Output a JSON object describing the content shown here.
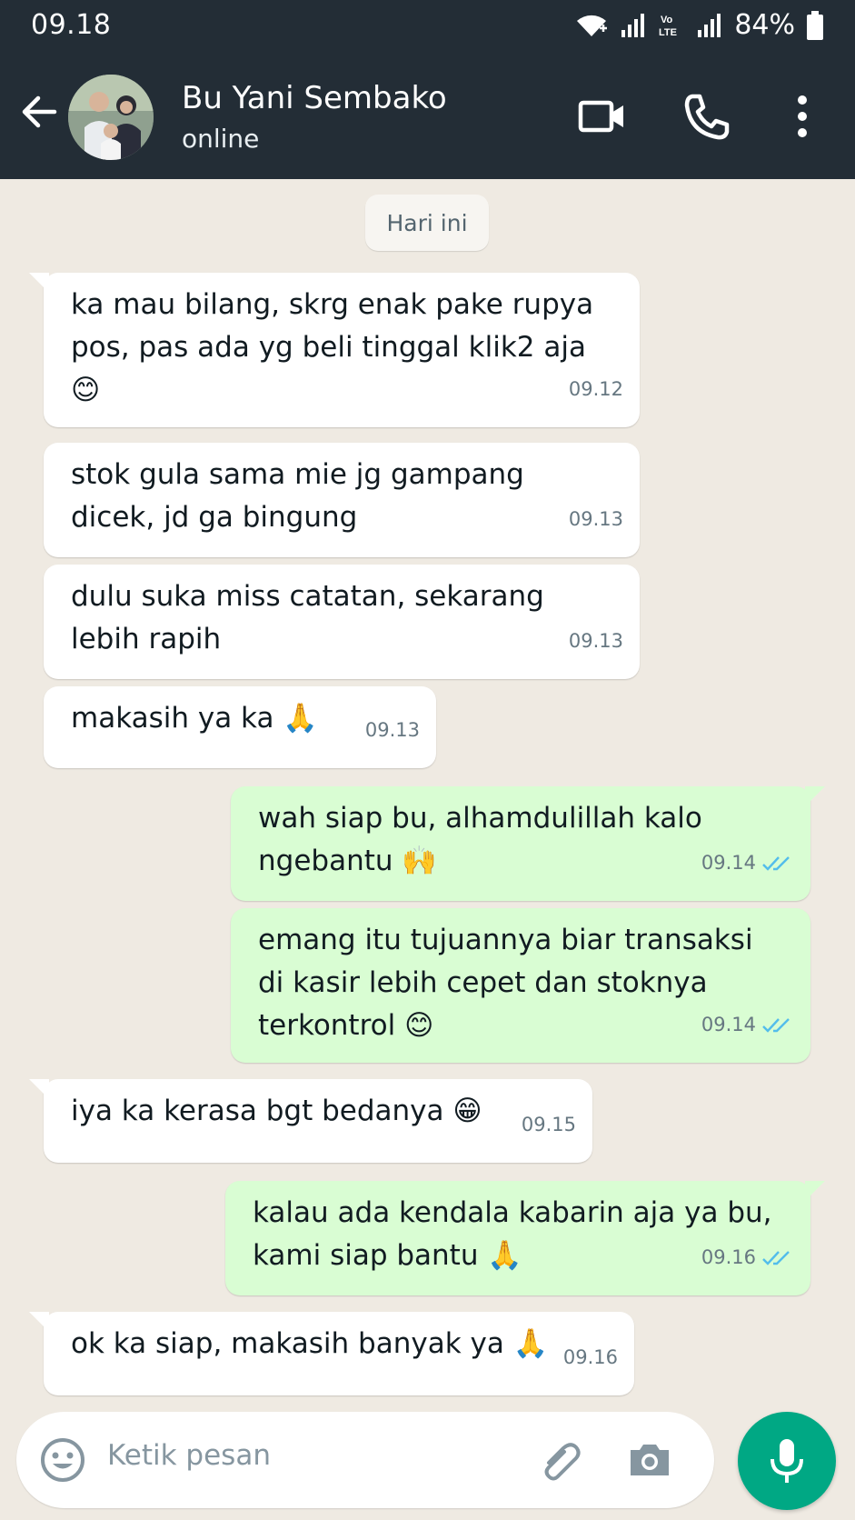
{
  "status_bar": {
    "time": "09.18",
    "battery": "84%",
    "network_label": "Vo LTE"
  },
  "header": {
    "contact_name": "Bu Yani Sembako",
    "status": "online"
  },
  "chat": {
    "date_chip": "Hari ini",
    "messages": [
      {
        "dir": "in",
        "text": "ka mau bilang, skrg enak pake rupya pos, pas ada yg beli tinggal klik2 aja 😊",
        "time": "09.12"
      },
      {
        "dir": "in",
        "text": "stok gula sama mie jg gampang dicek, jd ga bingung",
        "time": "09.13"
      },
      {
        "dir": "in",
        "text": "dulu suka miss catatan, sekarang lebih rapih",
        "time": "09.13"
      },
      {
        "dir": "in",
        "text": "makasih ya ka 🙏",
        "time": "09.13"
      },
      {
        "dir": "out",
        "text": "wah siap bu, alhamdulillah kalo ngebantu 🙌",
        "time": "09.14"
      },
      {
        "dir": "out",
        "text": "emang itu tujuannya biar transaksi di kasir lebih cepet dan stoknya terkontrol 😊",
        "time": "09.14"
      },
      {
        "dir": "in",
        "text": "iya ka kerasa bgt bedanya 😁",
        "time": "09.15"
      },
      {
        "dir": "out",
        "text": "kalau ada kendala kabarin aja ya bu, kami siap bantu 🙏",
        "time": "09.16"
      },
      {
        "dir": "in",
        "text": "ok ka siap, makasih banyak ya 🙏",
        "time": "09.16"
      }
    ]
  },
  "input": {
    "placeholder": "Ketik pesan"
  },
  "colors": {
    "header": "#232d36",
    "incoming": "#ffffff",
    "outgoing": "#d9fdd3",
    "accent": "#00a884",
    "read_ticks": "#53bdeb"
  }
}
